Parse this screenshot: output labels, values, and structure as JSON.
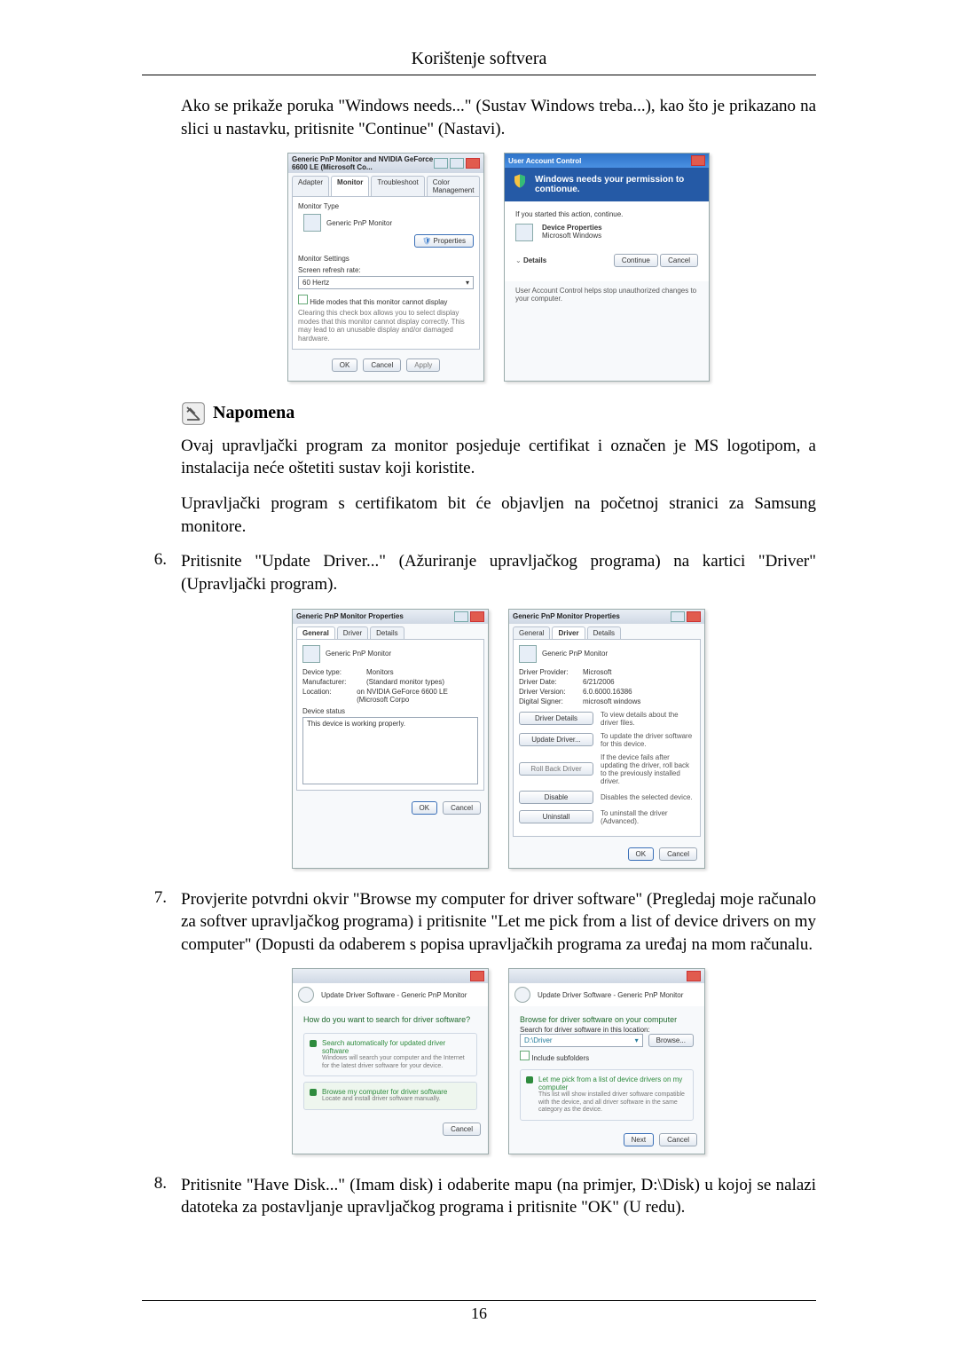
{
  "header": "Korištenje softvera",
  "intro": "Ako se prikaže poruka \"Windows needs...\" (Sustav Windows treba...), kao što je prikazano na slici u nastavku, pritisnite \"Continue\" (Nastavi).",
  "note_title": "Napomena",
  "note_p1": "Ovaj upravljački program za monitor posjeduje certifikat i označen je MS logotipom, a instalacija neće oštetiti sustav koji koristite.",
  "note_p2": "Upravljački program s certifikatom bit će objavljen na početnoj stranici za Samsung monitore.",
  "steps": {
    "s6": "Pritisnite \"Update Driver...\" (Ažuriranje upravljačkog programa) na kartici \"Driver\" (Upravljački program).",
    "s7": "Provjerite potvrdni okvir \"Browse my computer for driver software\" (Pregledaj moje računalo za softver upravljačkog programa) i pritisnite \"Let me pick from a list of device drivers on my computer\" (Dopusti da odaberem s popisa upravljačkih programa za uređaj na mom računalu.",
    "s8": "Pritisnite \"Have Disk...\" (Imam disk) i odaberite mapu (na primjer, D:\\Disk) u kojoj se nalazi datoteka za postavljanje upravljačkog programa i pritisnite \"OK\" (U redu)."
  },
  "fig1": {
    "title": "Generic PnP Monitor and NVIDIA GeForce 6600 LE (Microsoft Co...",
    "tabs": [
      "Adapter",
      "Monitor",
      "Troubleshoot",
      "Color Management"
    ],
    "monitor_type_label": "Monitor Type",
    "monitor_type_value": "Generic PnP Monitor",
    "properties_btn": "Properties",
    "settings_label": "Monitor Settings",
    "refresh_label": "Screen refresh rate:",
    "refresh_value": "60 Hertz",
    "hide_modes": "Hide modes that this monitor cannot display",
    "clearing_text": "Clearing this check box allows you to select display modes that this monitor cannot display correctly. This may lead to an unusable display and/or damaged hardware.",
    "ok": "OK",
    "cancel": "Cancel",
    "apply": "Apply"
  },
  "fig2": {
    "title": "User Account Control",
    "heading": "Windows needs your permission to contionue.",
    "if_started": "If you started this action, continue.",
    "dev_prop": "Device Properties",
    "vendor": "Microsoft Windows",
    "details": "Details",
    "continue": "Continue",
    "cancel": "Cancel",
    "footer": "User Account Control helps stop unauthorized changes to your computer."
  },
  "fig3": {
    "title": "Generic PnP Monitor Properties",
    "tabs": [
      "General",
      "Driver",
      "Details"
    ],
    "device_name": "Generic PnP Monitor",
    "rows": {
      "device_type_k": "Device type:",
      "device_type_v": "Monitors",
      "manufacturer_k": "Manufacturer:",
      "manufacturer_v": "(Standard monitor types)",
      "location_k": "Location:",
      "location_v": "on NVIDIA GeForce 6600 LE (Microsoft Corpo"
    },
    "device_status_label": "Device status",
    "device_status_text": "This device is working properly.",
    "ok": "OK",
    "cancel": "Cancel"
  },
  "fig4": {
    "title": "Generic PnP Monitor Properties",
    "tabs": [
      "General",
      "Driver",
      "Details"
    ],
    "device_name": "Generic PnP Monitor",
    "rows": {
      "provider_k": "Driver Provider:",
      "provider_v": "Microsoft",
      "date_k": "Driver Date:",
      "date_v": "6/21/2006",
      "version_k": "Driver Version:",
      "version_v": "6.0.6000.16386",
      "signer_k": "Digital Signer:",
      "signer_v": "microsoft windows"
    },
    "btns": {
      "details": "Driver Details",
      "details_d": "To view details about the driver files.",
      "update": "Update Driver...",
      "update_d": "To update the driver software for this device.",
      "rollback": "Roll Back Driver",
      "rollback_d": "If the device fails after updating the driver, roll back to the previously installed driver.",
      "disable": "Disable",
      "disable_d": "Disables the selected device.",
      "uninstall": "Uninstall",
      "uninstall_d": "To uninstall the driver (Advanced)."
    },
    "ok": "OK",
    "cancel": "Cancel"
  },
  "fig5": {
    "title": "Update Driver Software - Generic PnP Monitor",
    "question": "How do you want to search for driver software?",
    "opt1_t": "Search automatically for updated driver software",
    "opt1_d": "Windows will search your computer and the Internet for the latest driver software for your device.",
    "opt2_t": "Browse my computer for driver software",
    "opt2_d": "Locate and install driver software manually.",
    "cancel": "Cancel"
  },
  "fig6": {
    "title": "Update Driver Software - Generic PnP Monitor",
    "heading": "Browse for driver software on your computer",
    "search_label": "Search for driver software in this location:",
    "path_value": "D:\\Driver",
    "browse_btn": "Browse...",
    "include": "Include subfolders",
    "opt_t": "Let me pick from a list of device drivers on my computer",
    "opt_d": "This list will show installed driver software compatible with the device, and all driver software in the same category as the device.",
    "next": "Next",
    "cancel": "Cancel"
  },
  "page_number": "16"
}
